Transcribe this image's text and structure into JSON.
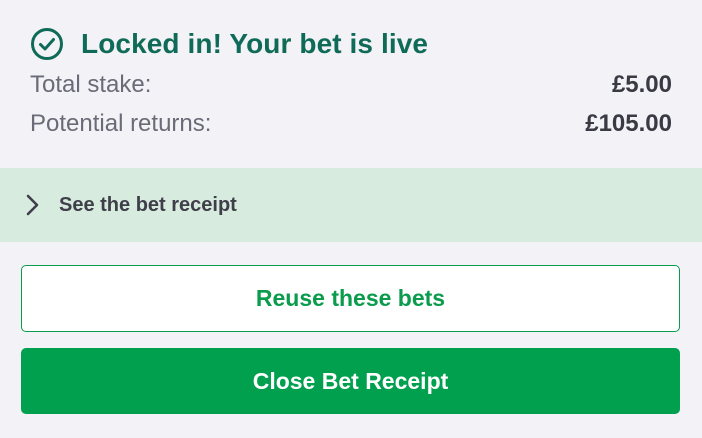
{
  "status": {
    "icon": "check-circle-icon",
    "title": "Locked in! Your bet is live",
    "color": "#0f6b57"
  },
  "summary": {
    "total_stake_label": "Total stake:",
    "total_stake_value": "£5.00",
    "potential_returns_label": "Potential returns:",
    "potential_returns_value": "£105.00"
  },
  "receipt_toggle": {
    "icon": "chevron-right-icon",
    "label": "See the bet receipt",
    "background": "#d8ebdf"
  },
  "actions": {
    "reuse_label": "Reuse these bets",
    "close_label": "Close Bet Receipt",
    "accent": "#00a04f"
  }
}
